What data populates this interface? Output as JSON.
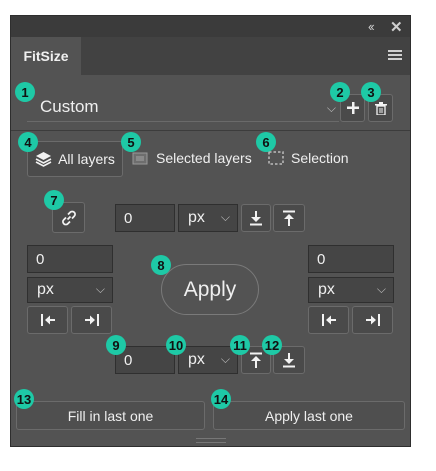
{
  "window": {
    "collapse_glyph": "‹‹",
    "close_glyph": "✕",
    "tab_title": "FitSize",
    "panel_menu_icon": "hamburger-icon"
  },
  "preset": {
    "value": "Custom",
    "add_icon": "plus-icon",
    "delete_icon": "trash-icon"
  },
  "modes": [
    {
      "label": "All layers",
      "icon": "layers-icon",
      "selected": true
    },
    {
      "label": "Selected layers",
      "icon": "selected-layer-icon",
      "selected": false
    },
    {
      "label": "Selection",
      "icon": "marquee-icon",
      "selected": false
    }
  ],
  "link_icon": "chain-link-icon",
  "top": {
    "value": "0",
    "unit": "px"
  },
  "left": {
    "value": "0",
    "unit": "px"
  },
  "right": {
    "value": "0",
    "unit": "px"
  },
  "bottom": {
    "value": "0",
    "unit": "px"
  },
  "apply_label": "Apply",
  "fill_last_label": "Fill in last one",
  "apply_last_label": "Apply last one",
  "badges": [
    "1",
    "2",
    "3",
    "4",
    "5",
    "6",
    "7",
    "8",
    "9",
    "10",
    "11",
    "12",
    "13",
    "14"
  ],
  "accent_color": "#1ec9a6"
}
